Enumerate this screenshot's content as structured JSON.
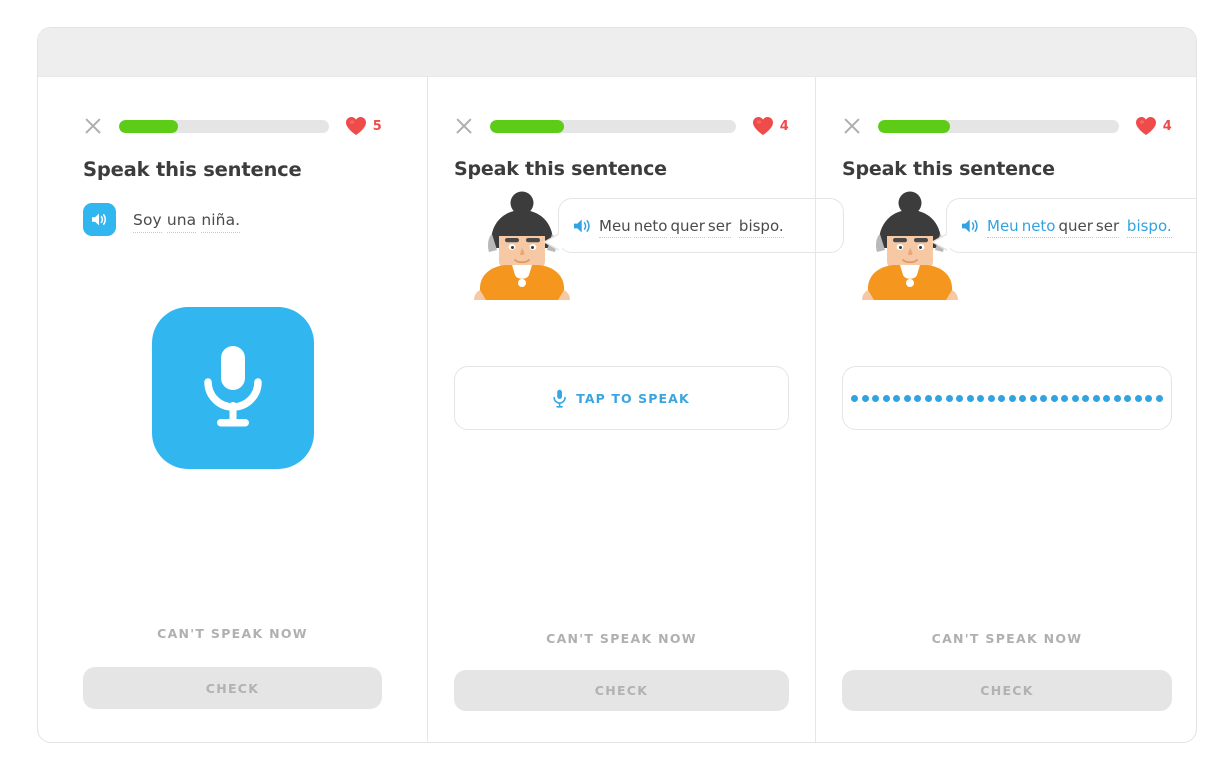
{
  "app": {
    "background_color": "#ffffff",
    "frame_border_color": "#e3e3e3",
    "titlebar_color": "#eeeeee"
  },
  "theme": {
    "brand_blue": "#31b6f0",
    "text_blue": "#31a3e0",
    "progress_green": "#5ccc16",
    "heart_red": "#ef4b4b",
    "text_dark": "#4b4b4b",
    "muted_gray": "#b0b0b0",
    "track_gray": "#e5e5e5",
    "shirt_orange": "#f5961e"
  },
  "panels": [
    {
      "id": "panel-speak-idle",
      "header": {
        "close_icon": "close-x-icon",
        "progress_percent": 28,
        "heart_icon": "heart-icon",
        "heart_count": "5"
      },
      "title": "Speak this sentence",
      "audio_prompt": {
        "speaker_icon": "speaker-icon",
        "sentence": "Soy una niña.",
        "words": [
          "Soy",
          "una",
          "niña."
        ]
      },
      "mic_button": {
        "icon": "microphone-icon",
        "label": ""
      },
      "footer": {
        "cant_speak_label": "CAN'T SPEAK NOW",
        "check_label": "CHECK"
      }
    },
    {
      "id": "panel-tap-to-speak",
      "header": {
        "close_icon": "close-x-icon",
        "progress_percent": 30,
        "heart_icon": "heart-icon",
        "heart_count": "4"
      },
      "title": "Speak this sentence",
      "character": {
        "name": "character-avatar-lucy",
        "hair_color": "#3c3c3c",
        "skin_color": "#f6c9a4",
        "shirt_color": "#f5961e"
      },
      "bubble": {
        "speaker_icon": "speaker-icon",
        "sentence": "Meu neto quer ser bispo.",
        "words": [
          {
            "text": "Meu",
            "recognized": false
          },
          {
            "text": "neto",
            "recognized": false
          },
          {
            "text": "quer",
            "recognized": false
          },
          {
            "text": "ser",
            "recognized": false
          },
          {
            "text": "bispo.",
            "recognized": false
          }
        ]
      },
      "speak_box": {
        "mic_icon": "microphone-icon",
        "label": "TAP TO SPEAK"
      },
      "footer": {
        "cant_speak_label": "CAN'T SPEAK NOW",
        "check_label": "CHECK"
      }
    },
    {
      "id": "panel-listening",
      "header": {
        "close_icon": "close-x-icon",
        "progress_percent": 30,
        "heart_icon": "heart-icon",
        "heart_count": "4"
      },
      "title": "Speak this sentence",
      "character": {
        "name": "character-avatar-lucy",
        "hair_color": "#3c3c3c",
        "skin_color": "#f6c9a4",
        "shirt_color": "#f5961e"
      },
      "bubble": {
        "speaker_icon": "speaker-icon",
        "sentence": "Meu neto quer ser bispo.",
        "words": [
          {
            "text": "Meu",
            "recognized": true
          },
          {
            "text": "neto",
            "recognized": true
          },
          {
            "text": "quer",
            "recognized": false
          },
          {
            "text": "ser",
            "recognized": false
          },
          {
            "text": "bispo.",
            "recognized": true
          }
        ]
      },
      "speak_box": {
        "waveform_icon": "listening-dots-icon",
        "dot_count": 30,
        "label": ""
      },
      "footer": {
        "cant_speak_label": "CAN'T SPEAK NOW",
        "check_label": "CHECK"
      }
    }
  ]
}
